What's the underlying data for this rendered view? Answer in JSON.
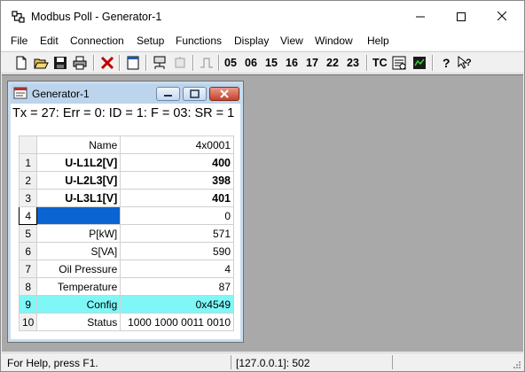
{
  "app": {
    "title": "Modbus Poll - Generator-1",
    "icon": "modbus-app-icon",
    "window_controls": [
      "minimize-icon",
      "maximize-icon",
      "close-icon"
    ]
  },
  "menu": [
    "File",
    "Edit",
    "Connection",
    "Setup",
    "Functions",
    "Display",
    "View",
    "Window",
    "Help"
  ],
  "toolbar": {
    "function_codes": [
      "05",
      "06",
      "15",
      "16",
      "17",
      "22",
      "23"
    ],
    "tc_label": "TC",
    "icons": [
      "new-icon",
      "open-icon",
      "save-icon",
      "print-icon",
      "delete-icon",
      "window-icon",
      "connect-icon",
      "disconnect-icon",
      "single-read-icon",
      "comm-traffic-icon",
      "monitor-icon",
      "help-icon",
      "context-help-icon"
    ]
  },
  "child": {
    "title": "Generator-1",
    "status_line": "Tx = 27: Err = 0: ID = 1: F = 03: SR = 1",
    "header": {
      "name": "Name",
      "value": "4x0001"
    },
    "rows": [
      {
        "idx": "0",
        "name": "U-L1L2[V]",
        "value": "400",
        "bold": true
      },
      {
        "idx": "1",
        "name": "U-L2L3[V]",
        "value": "398",
        "bold": true
      },
      {
        "idx": "2",
        "name": "U-L3L1[V]",
        "value": "401",
        "bold": true
      },
      {
        "idx": "3",
        "name": "",
        "value": "0",
        "selected": true
      },
      {
        "idx": "4",
        "name": "P[kW]",
        "value": "571"
      },
      {
        "idx": "5",
        "name": "S[VA]",
        "value": "590"
      },
      {
        "idx": "6",
        "name": "Oil Pressure",
        "value": "4"
      },
      {
        "idx": "7",
        "name": "Temperature",
        "value": "87"
      },
      {
        "idx": "8",
        "name": "Config",
        "value": "0x4549",
        "highlight": true
      },
      {
        "idx": "9",
        "name": "Status",
        "value": "1000 1000 0011 0010"
      }
    ],
    "row_numbers": [
      "1",
      "2",
      "3",
      "4",
      "5",
      "6",
      "7",
      "8",
      "9",
      "10"
    ]
  },
  "statusbar": {
    "help": "For Help, press F1.",
    "connection": "[127.0.0.1]: 502"
  },
  "colors": {
    "selection": "#0a64d2",
    "highlight": "#7ff7f7",
    "workspace": "#a9a9a9",
    "child_title": "#bcd4ec"
  }
}
